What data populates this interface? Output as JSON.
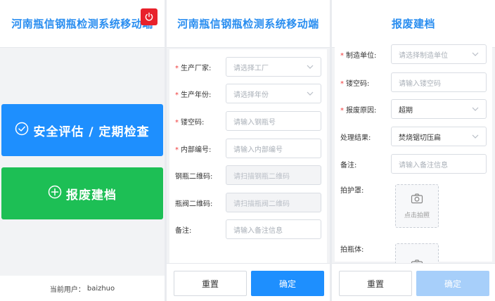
{
  "screen1": {
    "title": "河南瓶信钢瓶检测系统移动端",
    "safety_label": "安全评估 / 定期检查",
    "scrap_label": "报废建档",
    "user_prefix": "当前用户：",
    "user_name": "baizhuo"
  },
  "screen2": {
    "title": "河南瓶信钢瓶检测系统移动端",
    "fields": {
      "manufacturer": {
        "label": "生产厂家:",
        "placeholder": "请选择工厂"
      },
      "year": {
        "label": "生产年份:",
        "placeholder": "请选择年份"
      },
      "stamp": {
        "label": "镂空码:",
        "placeholder": "请输入钢瓶号"
      },
      "internal": {
        "label": "内部编号:",
        "placeholder": "请输入内部编号"
      },
      "qr_cyl": {
        "label": "钢瓶二维码:",
        "placeholder": "请扫描钢瓶二维码"
      },
      "qr_valve": {
        "label": "瓶阀二维码:",
        "placeholder": "请扫描瓶阀二维码"
      },
      "note": {
        "label": "备注:",
        "placeholder": "请输入备注信息"
      }
    },
    "reset_label": "重置",
    "ok_label": "确定"
  },
  "screen3": {
    "title": "报废建档",
    "fields": {
      "maker": {
        "label": "制造单位:",
        "placeholder": "请选择制造单位"
      },
      "stamp": {
        "label": "镂空码:",
        "placeholder": "请输入镂空码"
      },
      "reason": {
        "label": "报废原因:",
        "value": "超期"
      },
      "result": {
        "label": "处理结果:",
        "value": "焚烧锯切压扁"
      },
      "note": {
        "label": "备注:",
        "placeholder": "请输入备注信息"
      }
    },
    "photo_cover_label": "拍护罩:",
    "photo_tap_label": "点击拍照",
    "photo_body_label": "拍瓶体:",
    "reset_label": "重置",
    "ok_label": "确定"
  },
  "colors": {
    "brand_blue": "#1e8ffe",
    "green": "#1dbf55",
    "red": "#e8212b",
    "required": "#f03a3a"
  },
  "icons": [
    "power-icon",
    "check-circle-icon",
    "plus-circle-icon",
    "chevron-down-icon",
    "camera-icon"
  ]
}
